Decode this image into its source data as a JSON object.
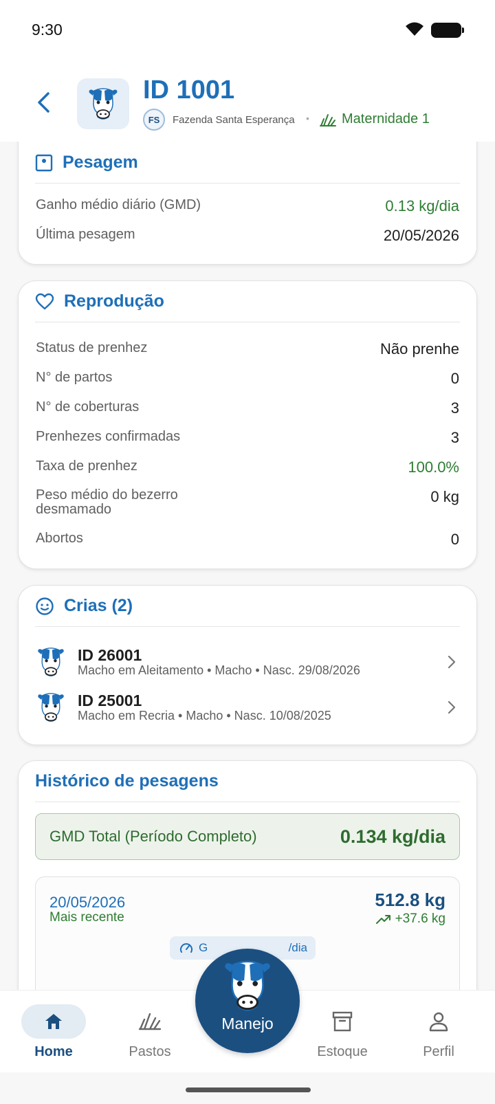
{
  "status_bar": {
    "time": "9:30"
  },
  "header": {
    "title": "ID 1001",
    "farm_badge": "FS",
    "farm_name": "Fazenda Santa Esperança",
    "separator": "•",
    "pasture": "Maternidade 1"
  },
  "pesagem": {
    "title": "Pesagem",
    "rows": [
      {
        "label": "Ganho médio diário (GMD)",
        "value": "0.13 kg/dia"
      },
      {
        "label": "Última pesagem",
        "value": "20/05/2026"
      }
    ]
  },
  "reproducao": {
    "title": "Reprodução",
    "rows": [
      {
        "label": "Status de prenhez",
        "value": "Não prenhe"
      },
      {
        "label": "N° de partos",
        "value": "0"
      },
      {
        "label": "N° de coberturas",
        "value": "3"
      },
      {
        "label": "Prenhezes confirmadas",
        "value": "3"
      },
      {
        "label": "Taxa de prenhez",
        "value": "100.0%"
      },
      {
        "label": "Peso médio do bezerro desmamado",
        "value": "0 kg"
      },
      {
        "label": "Abortos",
        "value": "0"
      }
    ]
  },
  "crias": {
    "title": "Crias (2)",
    "items": [
      {
        "id": "ID 26001",
        "info": "Macho em Aleitamento • Macho • Nasc. 29/08/2026"
      },
      {
        "id": "ID 25001",
        "info": "Macho em Recria • Macho • Nasc. 10/08/2025"
      }
    ]
  },
  "historico": {
    "title": "Histórico de pesagens",
    "gmd_label": "GMD Total (Período Completo)",
    "gmd_value": "0.134 kg/dia",
    "entry": {
      "date": "20/05/2026",
      "tag": "Mais recente",
      "weight": "512.8 kg",
      "delta": "+37.6 kg",
      "chip_left": "G",
      "chip_right": "/dia"
    }
  },
  "bottom_nav": {
    "home": "Home",
    "pastos": "Pastos",
    "manejo": "Manejo",
    "estoque": "Estoque",
    "perfil": "Perfil"
  },
  "colors": {
    "primary": "#1e6fb8",
    "navy": "#1b4f80",
    "green": "#2e7d32"
  }
}
